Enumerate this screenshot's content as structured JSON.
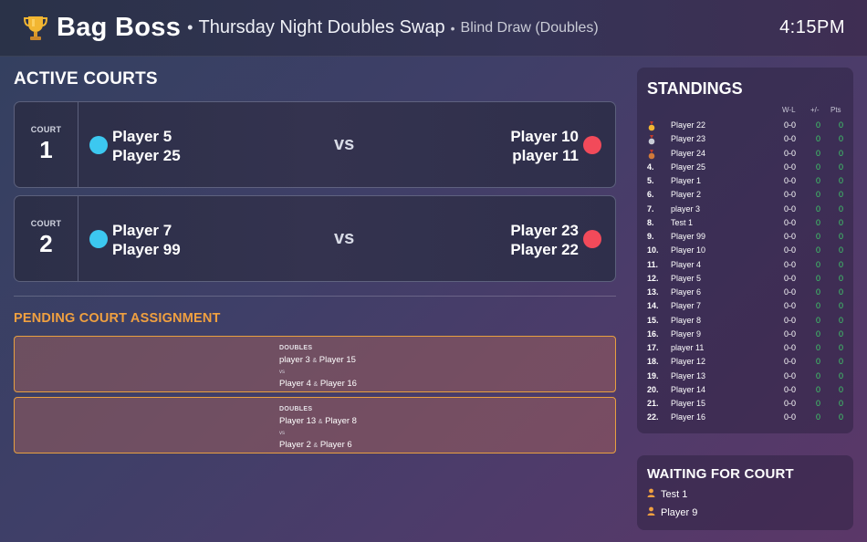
{
  "header": {
    "app_title": "Bag Boss",
    "separator": "•",
    "event_name": "Thursday Night Doubles Swap",
    "format": "Blind Draw (Doubles)",
    "clock": "4:15PM",
    "icon": "trophy-icon"
  },
  "active_courts": {
    "title": "ACTIVE COURTS",
    "vs_label": "vs",
    "court_label": "COURT",
    "courts": [
      {
        "number": "1",
        "team_a": [
          "Player 5",
          "Player 25"
        ],
        "team_b": [
          "Player 10",
          "player 11"
        ],
        "team_a_color": "#3cc8f0",
        "team_b_color": "#f24a5a"
      },
      {
        "number": "2",
        "team_a": [
          "Player 7",
          "Player 99"
        ],
        "team_b": [
          "Player 23",
          "Player 22"
        ],
        "team_a_color": "#3cc8f0",
        "team_b_color": "#f24a5a"
      }
    ]
  },
  "pending": {
    "title": "PENDING COURT ASSIGNMENT",
    "type_label": "DOUBLES",
    "vs_label": "vs",
    "amp": "&",
    "matches": [
      {
        "team_a": [
          "player 3",
          "Player 15"
        ],
        "team_b": [
          "Player 4",
          "Player 16"
        ]
      },
      {
        "team_a": [
          "Player 13",
          "Player 8"
        ],
        "team_b": [
          "Player 2",
          "Player 6"
        ]
      }
    ]
  },
  "standings": {
    "title": "STANDINGS",
    "columns": {
      "wl": "W-L",
      "pm": "+/-",
      "pts": "Pts"
    },
    "rows": [
      {
        "rank": "",
        "medal": "gold-medal-icon",
        "name": "Player 22",
        "wl": "0-0",
        "pm": "0",
        "pts": "0"
      },
      {
        "rank": "",
        "medal": "silver-medal-icon",
        "name": "Player 23",
        "wl": "0-0",
        "pm": "0",
        "pts": "0"
      },
      {
        "rank": "",
        "medal": "bronze-medal-icon",
        "name": "Player 24",
        "wl": "0-0",
        "pm": "0",
        "pts": "0"
      },
      {
        "rank": "4.",
        "name": "Player 25",
        "wl": "0-0",
        "pm": "0",
        "pts": "0"
      },
      {
        "rank": "5.",
        "name": "Player 1",
        "wl": "0-0",
        "pm": "0",
        "pts": "0"
      },
      {
        "rank": "6.",
        "name": "Player 2",
        "wl": "0-0",
        "pm": "0",
        "pts": "0"
      },
      {
        "rank": "7.",
        "name": "player 3",
        "wl": "0-0",
        "pm": "0",
        "pts": "0"
      },
      {
        "rank": "8.",
        "name": "Test 1",
        "wl": "0-0",
        "pm": "0",
        "pts": "0"
      },
      {
        "rank": "9.",
        "name": "Player 99",
        "wl": "0-0",
        "pm": "0",
        "pts": "0"
      },
      {
        "rank": "10.",
        "name": "Player 10",
        "wl": "0-0",
        "pm": "0",
        "pts": "0"
      },
      {
        "rank": "11.",
        "name": "Player 4",
        "wl": "0-0",
        "pm": "0",
        "pts": "0"
      },
      {
        "rank": "12.",
        "name": "Player 5",
        "wl": "0-0",
        "pm": "0",
        "pts": "0"
      },
      {
        "rank": "13.",
        "name": "Player 6",
        "wl": "0-0",
        "pm": "0",
        "pts": "0"
      },
      {
        "rank": "14.",
        "name": "Player 7",
        "wl": "0-0",
        "pm": "0",
        "pts": "0"
      },
      {
        "rank": "15.",
        "name": "Player 8",
        "wl": "0-0",
        "pm": "0",
        "pts": "0"
      },
      {
        "rank": "16.",
        "name": "Player 9",
        "wl": "0-0",
        "pm": "0",
        "pts": "0"
      },
      {
        "rank": "17.",
        "name": "player 11",
        "wl": "0-0",
        "pm": "0",
        "pts": "0"
      },
      {
        "rank": "18.",
        "name": "Player 12",
        "wl": "0-0",
        "pm": "0",
        "pts": "0"
      },
      {
        "rank": "19.",
        "name": "Player 13",
        "wl": "0-0",
        "pm": "0",
        "pts": "0"
      },
      {
        "rank": "20.",
        "name": "Player 14",
        "wl": "0-0",
        "pm": "0",
        "pts": "0"
      },
      {
        "rank": "21.",
        "name": "Player 15",
        "wl": "0-0",
        "pm": "0",
        "pts": "0"
      },
      {
        "rank": "22.",
        "name": "Player 16",
        "wl": "0-0",
        "pm": "0",
        "pts": "0"
      }
    ]
  },
  "waiting": {
    "title": "WAITING FOR COURT",
    "icon": "person-icon",
    "players": [
      "Test 1",
      "Player 9"
    ]
  },
  "colors": {
    "accent_orange": "#f0a040",
    "positive_green": "#3fd06a",
    "team_blue": "#3cc8f0",
    "team_red": "#f24a5a"
  }
}
